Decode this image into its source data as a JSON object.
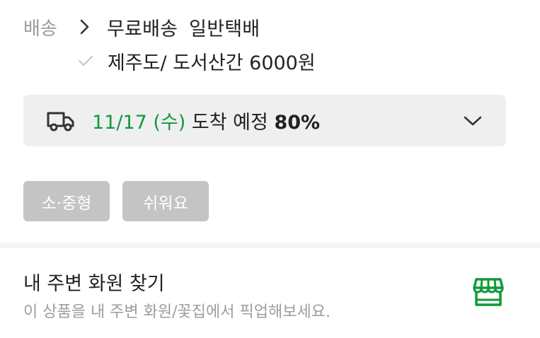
{
  "shipping": {
    "label": "배송",
    "free_shipping": "무료배송",
    "method": "일반택배",
    "extra_fee": "제주도/ 도서산간 6000원"
  },
  "delivery": {
    "date": "11/17 (수)",
    "arrival_text": "도착 예정",
    "probability": "80%"
  },
  "tags": [
    "소·중형",
    "쉬워요"
  ],
  "nearby": {
    "title": "내 주변 화원 찾기",
    "description": "이 상품을 내 주변 화원/꽃집에서 픽업해보세요."
  },
  "colors": {
    "accent_green": "#0f9a3b",
    "tag_gray": "#c4c4c4",
    "box_bg": "#efefef"
  },
  "icons": {
    "shipping_arrow": "chevron-right-icon",
    "extra_check": "check-icon",
    "delivery": "truck-icon",
    "expand": "chevron-down-icon",
    "store": "store-icon"
  }
}
